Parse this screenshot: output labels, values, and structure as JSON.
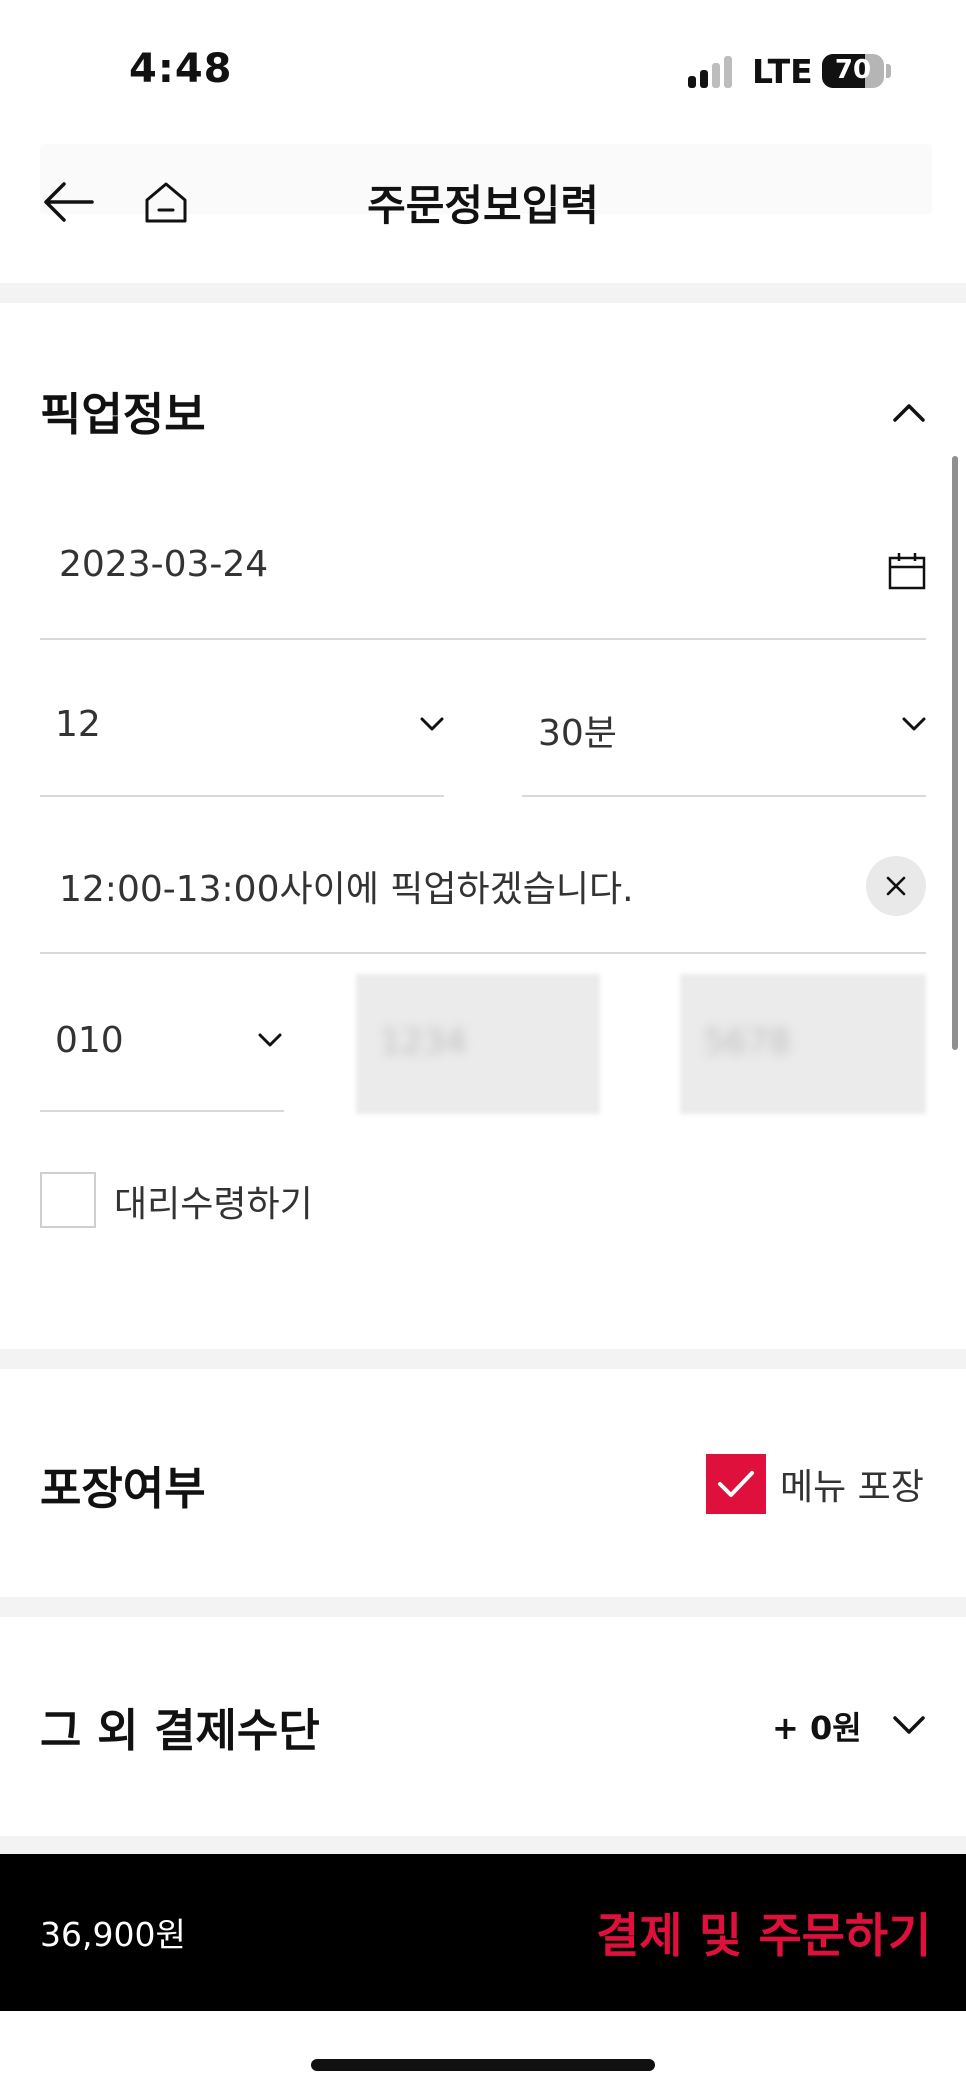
{
  "status_bar": {
    "time": "4:48",
    "network": "LTE",
    "battery": "70",
    "battery_level_percent": 70
  },
  "header": {
    "title": "주문정보입력",
    "back_icon": "arrow-left-icon",
    "home_icon": "home-icon"
  },
  "pickup": {
    "title": "픽업정보",
    "date": "2023-03-24",
    "hour": "12",
    "minute": "30분",
    "note": "12:00-13:00사이에 픽업하겠습니다.",
    "phone_prefix": "010",
    "phone_middle": "1234",
    "phone_last": "5678",
    "proxy_label": "대리수령하기",
    "proxy_checked": false
  },
  "packaging": {
    "title": "포장여부",
    "option_label": "메뉴 포장",
    "checked": true
  },
  "other_payment": {
    "title": "그 외 결제수단",
    "amount": "+ 0원"
  },
  "footer": {
    "total": "36,900원",
    "pay_button": "결제 및 주문하기"
  },
  "colors": {
    "accent": "#e0103c",
    "footer_bg": "#000000",
    "divider": "#f3f3f3"
  }
}
